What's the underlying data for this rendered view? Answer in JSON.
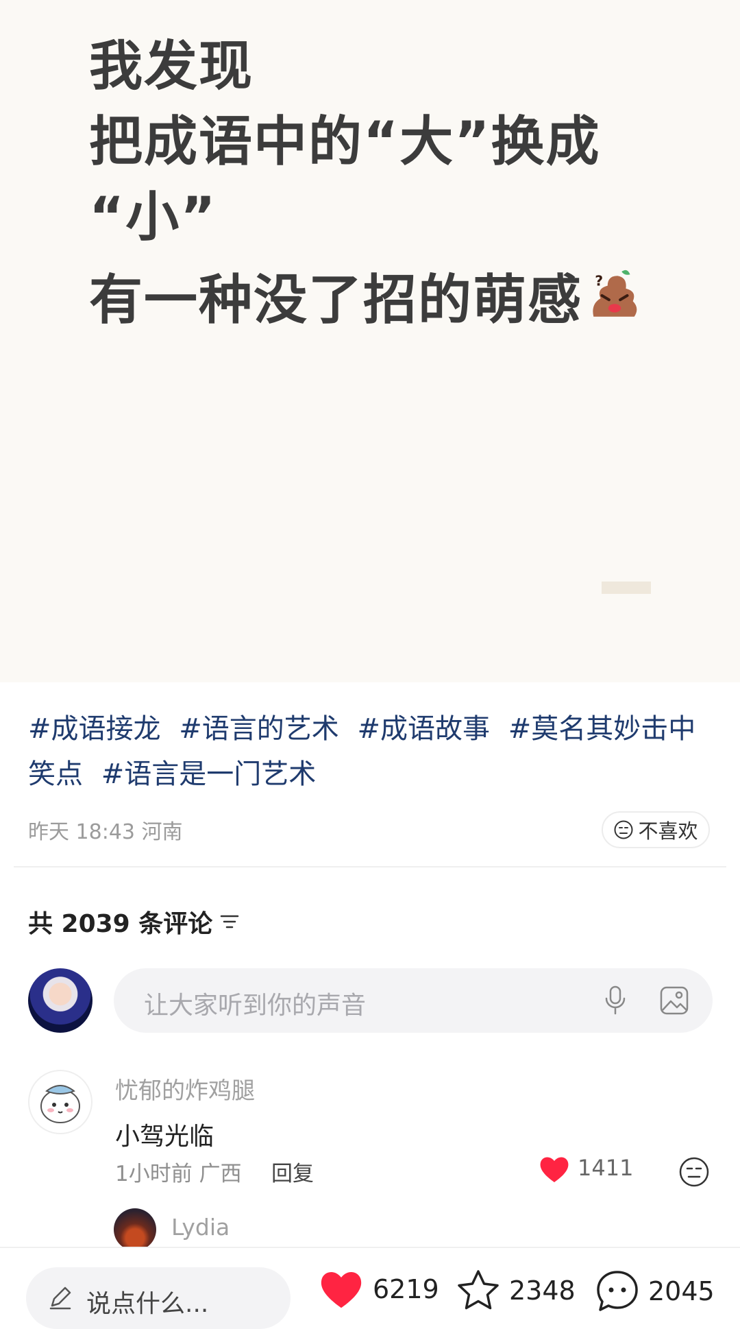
{
  "post": {
    "lines": [
      "我发现",
      "把成语中的“大”换成",
      "“小”",
      "有一种没了招的"
    ],
    "highlight": "萌感",
    "tags": [
      "#成语接龙",
      "#语言的艺术",
      "#成语故事",
      "#莫名其妙击中笑点",
      "#语言是一门艺术"
    ],
    "meta": "昨天 18:43 河南",
    "dislike_label": "不喜欢"
  },
  "comments_header": {
    "label": "共 2039 条评论"
  },
  "comment_input": {
    "placeholder": "让大家听到你的声音"
  },
  "comments": [
    {
      "user": "忧郁的炸鸡腿",
      "text": "小驾光临",
      "time_location": "1小时前 广西",
      "reply_label": "回复",
      "likes": "1411"
    }
  ],
  "sub_comment": {
    "user": "Lydia"
  },
  "bottom_bar": {
    "say_placeholder": "说点什么...",
    "likes": "6219",
    "favorites": "2348",
    "comments": "2045"
  },
  "colors": {
    "highlight": "#b6ef80",
    "tag": "#1f3b6e",
    "like_red": "#ff2442"
  },
  "icons": [
    "poop-emoji-icon",
    "dislike-face-icon",
    "sort-icon",
    "mic-icon",
    "image-icon",
    "heart-icon",
    "neutral-face-icon",
    "pen-icon",
    "star-icon",
    "comment-bubble-icon"
  ]
}
